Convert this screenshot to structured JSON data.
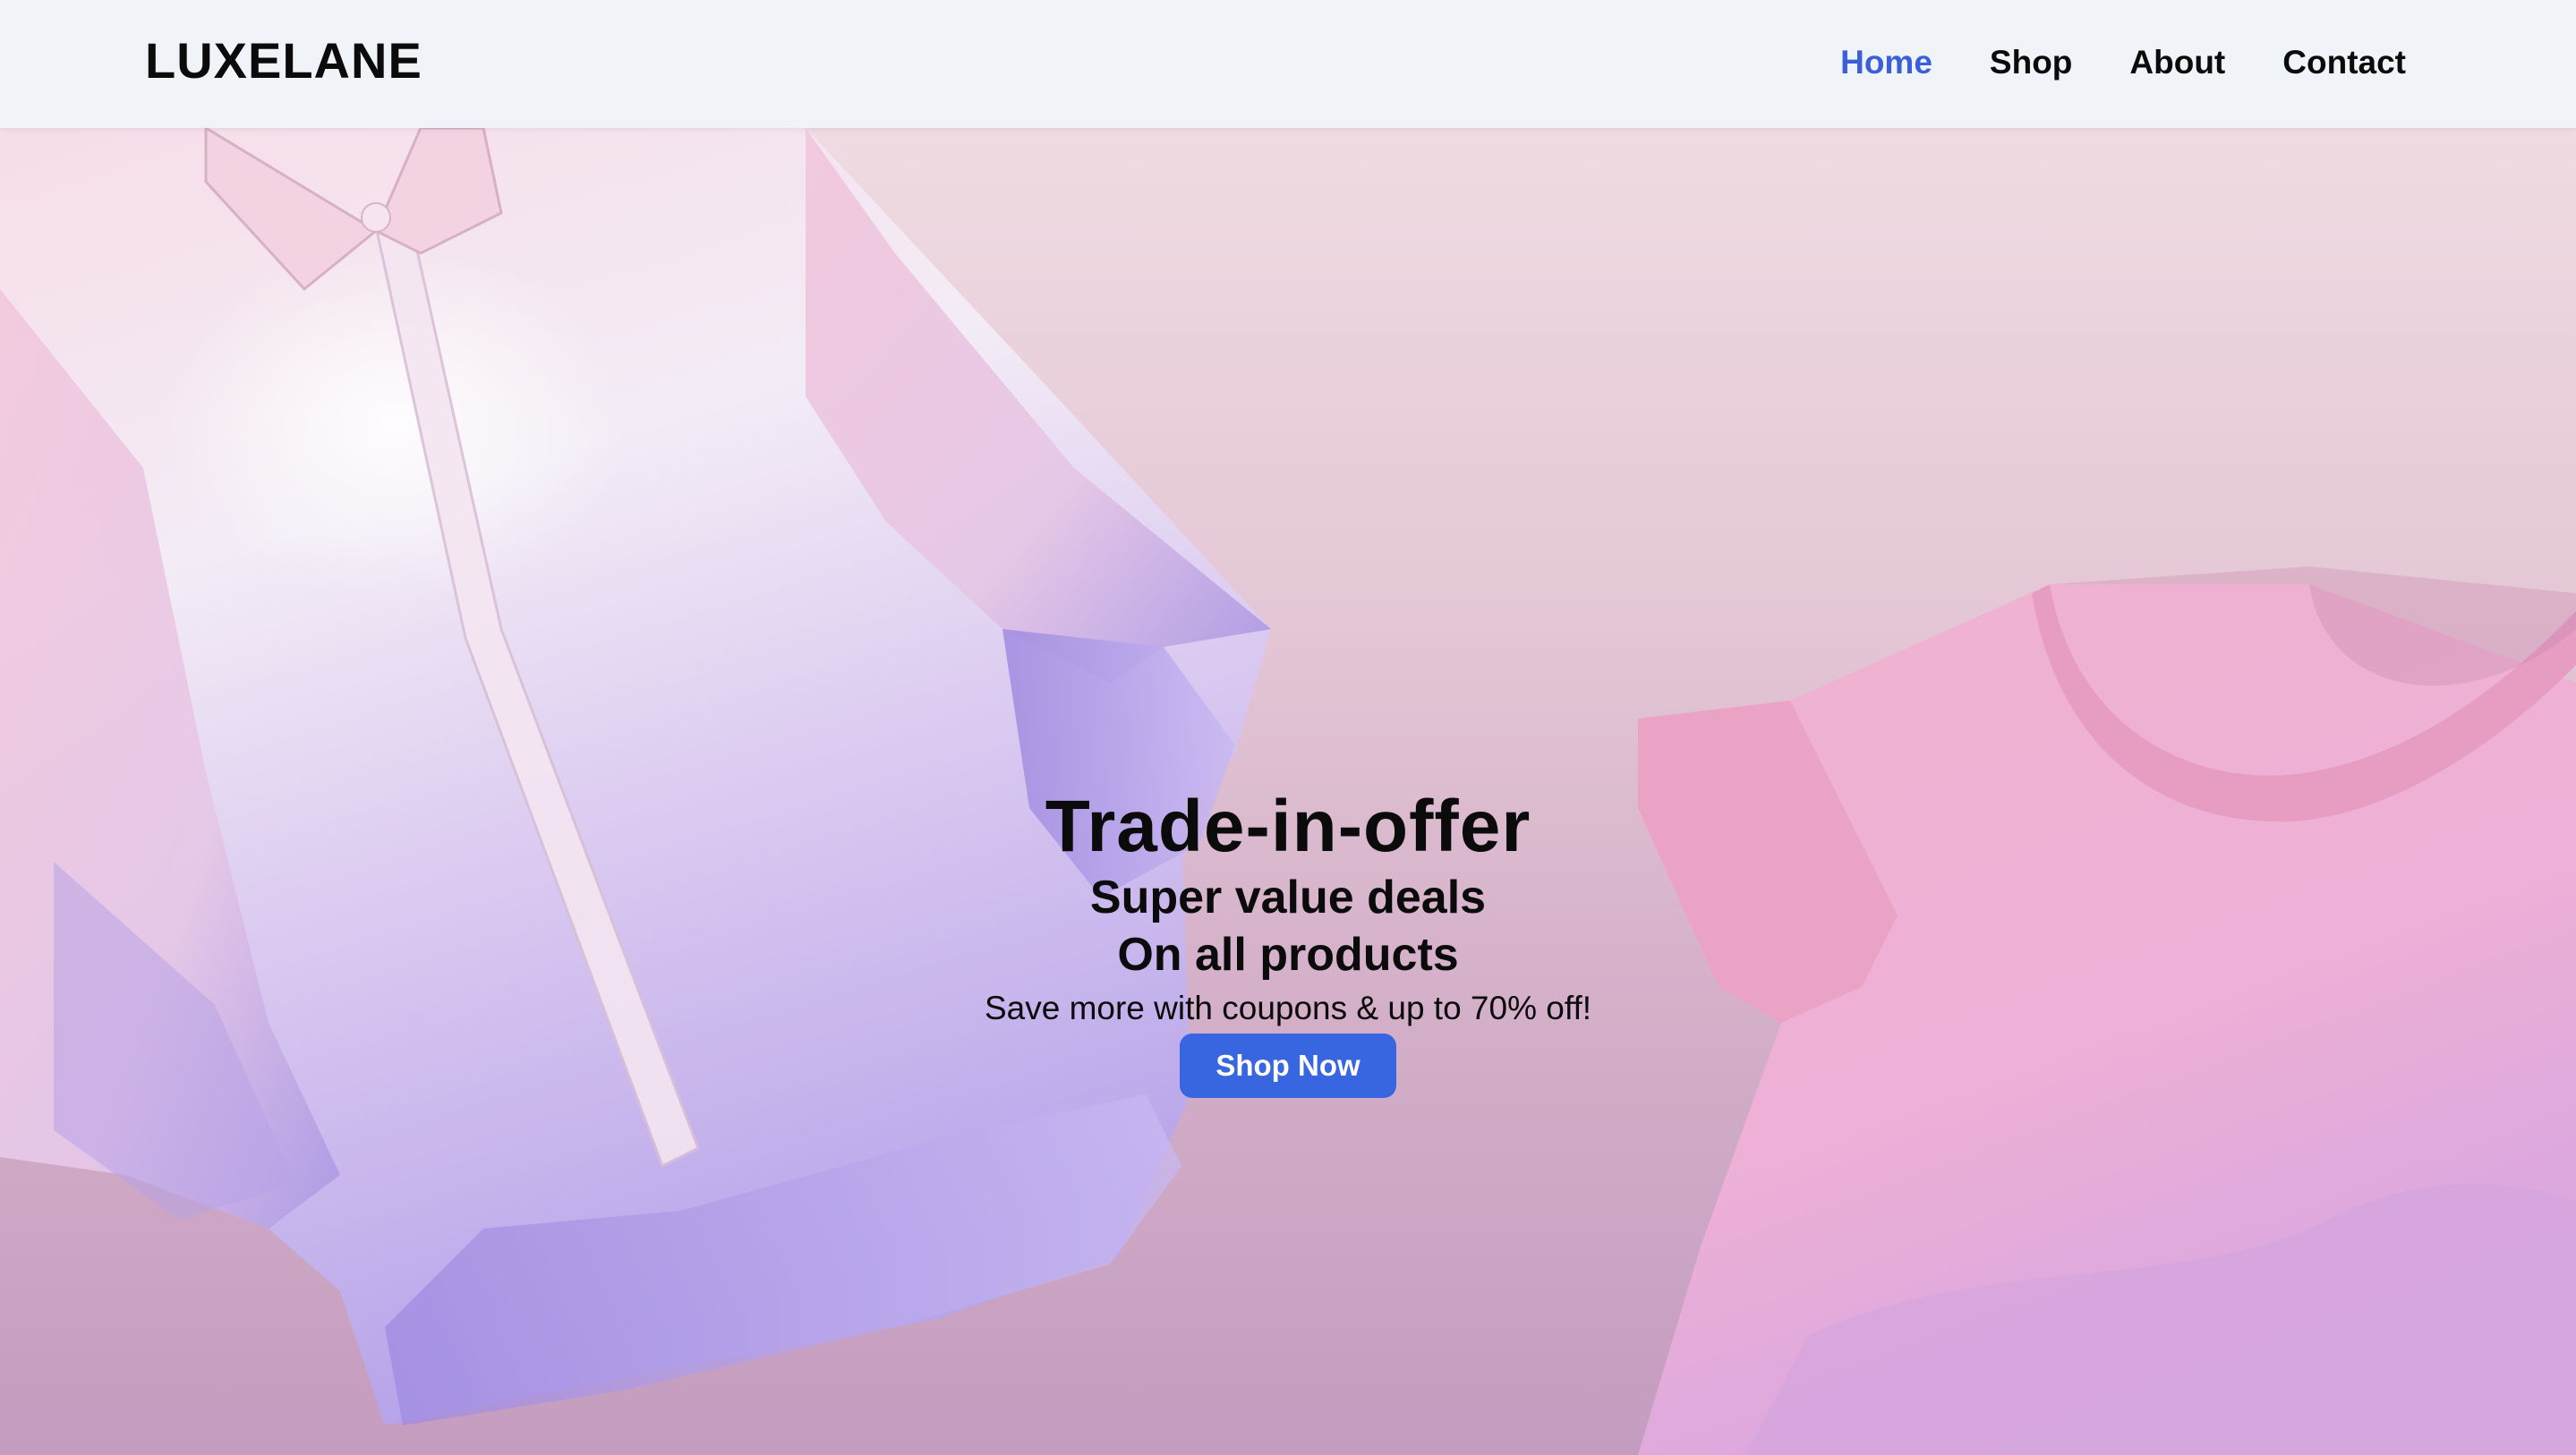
{
  "brand": {
    "logo": "LUXELANE"
  },
  "nav": {
    "items": [
      {
        "label": "Home",
        "active": true
      },
      {
        "label": "Shop",
        "active": false
      },
      {
        "label": "About",
        "active": false
      },
      {
        "label": "Contact",
        "active": false
      }
    ]
  },
  "hero": {
    "title": "Trade-in-offer",
    "subtitle_1": "Super value deals",
    "subtitle_2": "On all products",
    "note": "Save more with coupons & up to 70% off!",
    "cta_label": "Shop Now"
  },
  "colors": {
    "accent": "#3866e0",
    "active_nav": "#3a5fd9",
    "header_bg": "#f0f4f9",
    "text": "#0b0b0b"
  }
}
